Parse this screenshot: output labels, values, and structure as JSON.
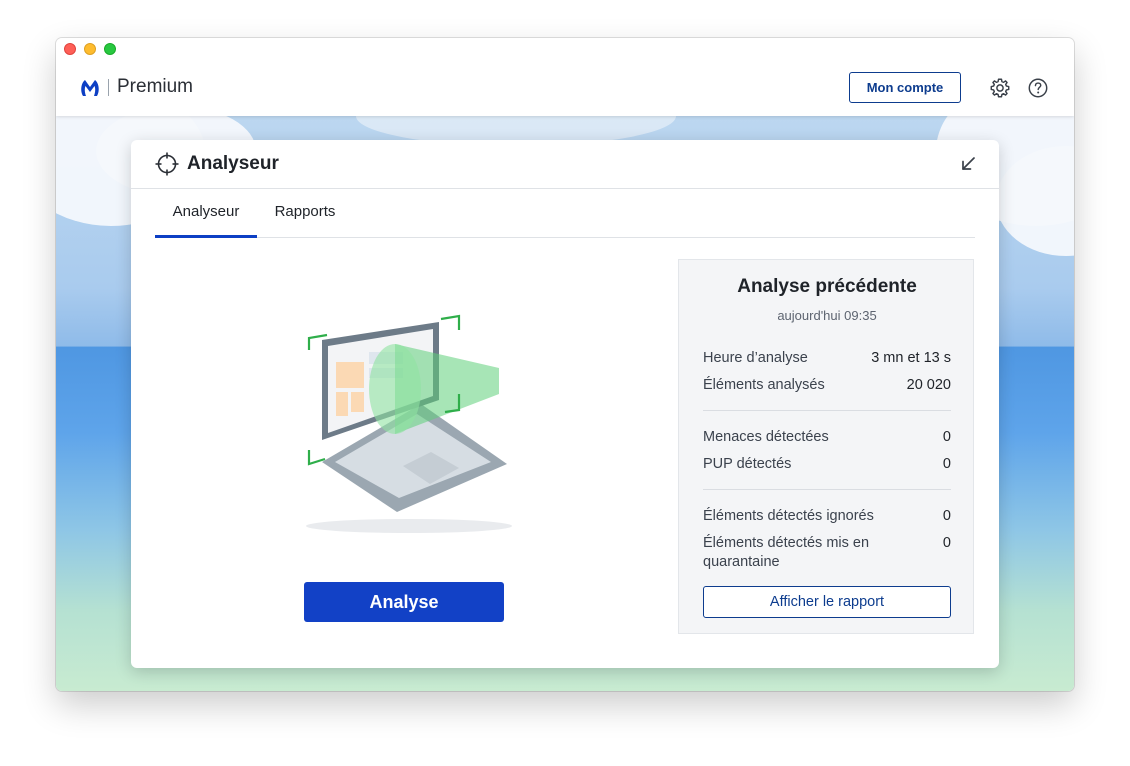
{
  "app": {
    "brand_name": "Premium",
    "brand_color": "#0d3fc4"
  },
  "header": {
    "account_label": "Mon compte",
    "icons": [
      "settings-gear-icon",
      "help-icon"
    ]
  },
  "card": {
    "title": "Analyseur",
    "tabs": [
      {
        "label": "Analyseur",
        "active": true
      },
      {
        "label": "Rapports",
        "active": false
      }
    ],
    "scan_button_label": "Analyse"
  },
  "previous_scan": {
    "title": "Analyse précédente",
    "date": "aujourd'hui 09:35",
    "groups": [
      [
        {
          "label": "Heure d’analyse",
          "value": "3 mn et 13 s"
        },
        {
          "label": "Éléments analysés",
          "value": "20 020"
        }
      ],
      [
        {
          "label": "Menaces détectées",
          "value": "0"
        },
        {
          "label": "PUP détectés",
          "value": "0"
        }
      ],
      [
        {
          "label": "Éléments détectés ignorés",
          "value": "0"
        },
        {
          "label": "Éléments détectés mis en quarantaine",
          "value": "0"
        }
      ]
    ],
    "report_button_label": "Afficher le rapport"
  },
  "colors": {
    "primary": "#1241c6",
    "outline": "#0d3c8e",
    "scan_beam": "#5fd07a"
  }
}
